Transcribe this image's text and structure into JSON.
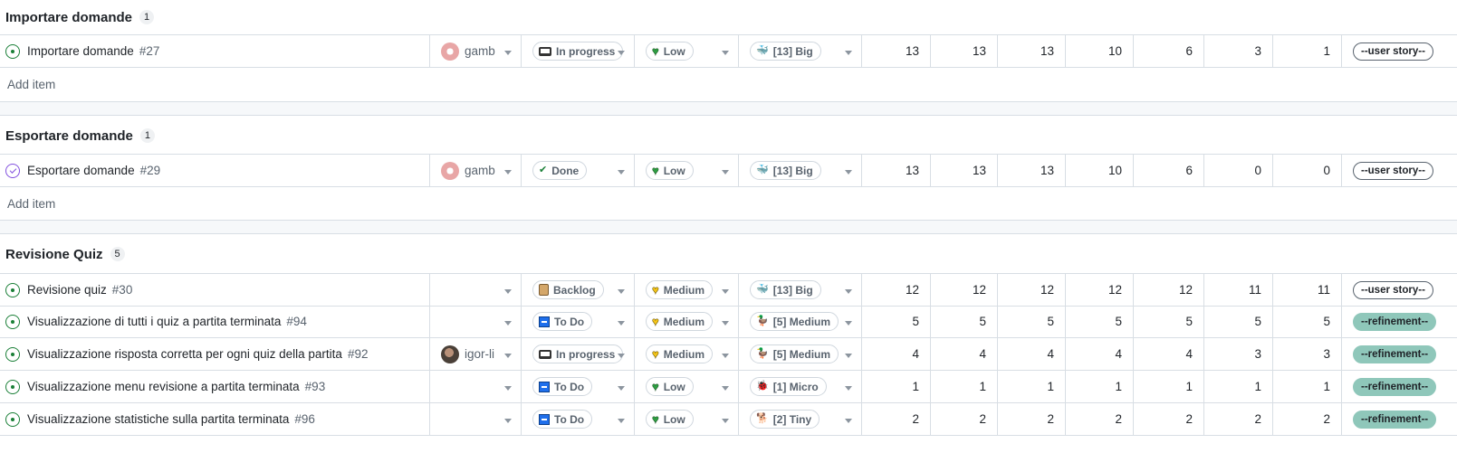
{
  "add_item_label": "Add item",
  "groups": [
    {
      "title": "Importare domande",
      "count": "1",
      "rows": [
        {
          "title": "Importare domande",
          "number": "#27",
          "state": "open",
          "assignee": "gamb",
          "status": "In progress",
          "priority": "Low",
          "size": "[13] Big",
          "values": [
            "13",
            "13",
            "13",
            "10",
            "6",
            "3",
            "1"
          ],
          "label": "--user story--"
        }
      ]
    },
    {
      "title": "Esportare domande",
      "count": "1",
      "rows": [
        {
          "title": "Esportare domande",
          "number": "#29",
          "state": "closed",
          "assignee": "gamb",
          "status": "Done",
          "priority": "Low",
          "size": "[13] Big",
          "values": [
            "13",
            "13",
            "13",
            "10",
            "6",
            "0",
            "0"
          ],
          "label": "--user story--"
        }
      ]
    },
    {
      "title": "Revisione Quiz",
      "count": "5",
      "rows": [
        {
          "title": "Revisione quiz",
          "number": "#30",
          "state": "open",
          "assignee": "",
          "status": "Backlog",
          "priority": "Medium",
          "size": "[13] Big",
          "values": [
            "12",
            "12",
            "12",
            "12",
            "12",
            "11",
            "11"
          ],
          "label": "--user story--"
        },
        {
          "title": "Visualizzazione di tutti i quiz a partita terminata",
          "number": "#94",
          "state": "open",
          "assignee": "",
          "status": "To Do",
          "priority": "Medium",
          "size": "[5] Medium",
          "values": [
            "5",
            "5",
            "5",
            "5",
            "5",
            "5",
            "5"
          ],
          "label": "--refinement--"
        },
        {
          "title": "Visualizzazione risposta corretta per ogni quiz della partita",
          "number": "#92",
          "state": "open",
          "assignee": "igor-li",
          "status": "In progress",
          "priority": "Medium",
          "size": "[5] Medium",
          "values": [
            "4",
            "4",
            "4",
            "4",
            "4",
            "3",
            "3"
          ],
          "label": "--refinement--"
        },
        {
          "title": "Visualizzazione menu revisione a partita terminata",
          "number": "#93",
          "state": "open",
          "assignee": "",
          "status": "To Do",
          "priority": "Low",
          "size": "[1] Micro",
          "values": [
            "1",
            "1",
            "1",
            "1",
            "1",
            "1",
            "1"
          ],
          "label": "--refinement--"
        },
        {
          "title": "Visualizzazione statistiche sulla partita terminata",
          "number": "#96",
          "state": "open",
          "assignee": "",
          "status": "To Do",
          "priority": "Low",
          "size": "[2] Tiny",
          "values": [
            "2",
            "2",
            "2",
            "2",
            "2",
            "2",
            "2"
          ],
          "label": "--refinement--"
        }
      ]
    }
  ],
  "colors": {
    "open_issue": "#1a7f37",
    "closed_issue": "#8250df",
    "refinement_label": "#8fc7ba",
    "low_priority": "#2ea043",
    "medium_priority": "#f5c518"
  }
}
